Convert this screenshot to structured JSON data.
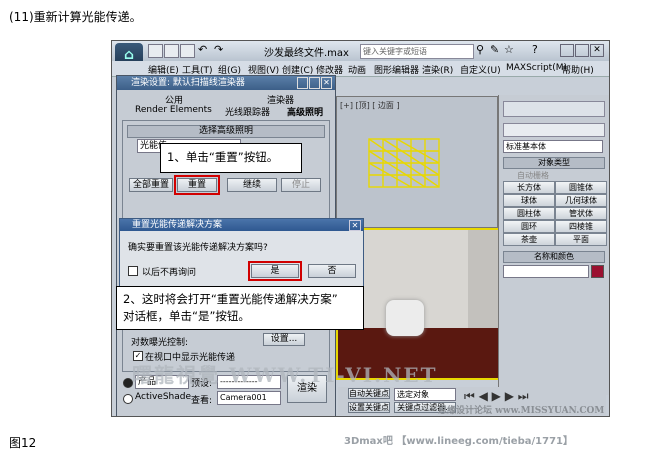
{
  "caption_top": "(11)重新计算光能传递。",
  "caption_bottom": "图12",
  "footer": "3Dmax吧 【www.lineeg.com/tieba/1771】",
  "app": {
    "title": "沙发最终文件.max",
    "search_placeholder": "键入关键字或短语",
    "menu": [
      "编辑(E)",
      "工具(T)",
      "组(G)",
      "视图(V)",
      "创建(C)",
      "修改器",
      "动画",
      "图形编辑器",
      "渲染(R)",
      "自定义(U)",
      "MAXScript(M)",
      "帮助(H)"
    ]
  },
  "render_setup": {
    "title": "渲染设置: 默认扫描线渲染器",
    "tabs_row1": [
      "公用",
      "渲染器"
    ],
    "tabs_row2": [
      "Render Elements",
      "光线跟踪器",
      "高级照明"
    ],
    "rollup_select": "选择高级照明",
    "option_value": "光能传",
    "buttons": {
      "reset_all": "全部重置",
      "reset": "重置",
      "continue": "继续",
      "stop": "停止"
    },
    "exposure_label": "对数曝光控制:",
    "setup_button": "设置...",
    "show_in_viewport": "在视口中显示光能传递",
    "mode_product": "产品",
    "mode_activeshade": "ActiveShade",
    "preset_label": "预设:",
    "preset_value": "-------------",
    "view_label": "查看:",
    "view_value": "Camera001",
    "render_button": "渲染"
  },
  "dialog": {
    "title": "重置光能传递解决方案",
    "message": "确实要重置该光能传递解决方案吗?",
    "dont_ask": "以后不再询问",
    "yes": "是",
    "no": "否"
  },
  "callouts": {
    "step1": "1、单击“重置”按钮。",
    "step2_line1": "2、这时将会打开“重置光能传递解决方案”",
    "step2_line2": "对话框，单击“是”按钮。"
  },
  "viewport_top_label": "[+] [顶] [ 边面 ]",
  "command_panel": {
    "dropdown": "标准基本体",
    "object_type": "对象类型",
    "auto_grid": "自动栅格",
    "objects": [
      "长方体",
      "圆锥体",
      "球体",
      "几何球体",
      "圆柱体",
      "管状体",
      "圆环",
      "四棱锥",
      "茶壶",
      "平面"
    ],
    "name_color": "名称和颜色"
  },
  "bottom": {
    "auto_key": "自动关键点",
    "select_object": "选定对象",
    "set_key": "设置关键点",
    "key_filter": "关键点过滤器..."
  },
  "watermark_left": "曙龍視覺 WWW.TI-VI.NET",
  "watermark_right": "思缘设计论坛 www.MISSYUAN.COM",
  "colors": {
    "red_highlight": "#d10000",
    "yellow_grid": "#e8d800",
    "floor": "#5a1810"
  }
}
